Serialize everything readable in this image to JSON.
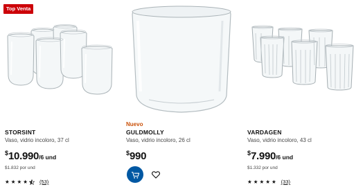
{
  "products": [
    {
      "badge": "Top Venta",
      "name": "STORSINT",
      "description": "Vaso, vidrio incoloro, 37 cl",
      "currency": "$",
      "price": "10.990",
      "unit": "/6 und",
      "unit_price": "$1.832 por und",
      "rating": 4.5,
      "reviews": "(53)"
    },
    {
      "tag": "Nuevo",
      "name": "GULDMOLLY",
      "description": "Vaso, vidrio incoloro, 26 cl",
      "currency": "$",
      "price": "990",
      "cart_icon": "add-to-cart-icon",
      "favorite_icon": "heart-icon"
    },
    {
      "name": "VARDAGEN",
      "description": "Vaso, vidrio incoloro, 43 cl",
      "currency": "$",
      "price": "7.990",
      "unit": "/6 und",
      "unit_price": "$1.332 por und",
      "rating": 5,
      "reviews": "(33)"
    }
  ],
  "colors": {
    "badge": "#cc0008",
    "nuevo": "#ca5008",
    "cart_button": "#0058a3"
  }
}
